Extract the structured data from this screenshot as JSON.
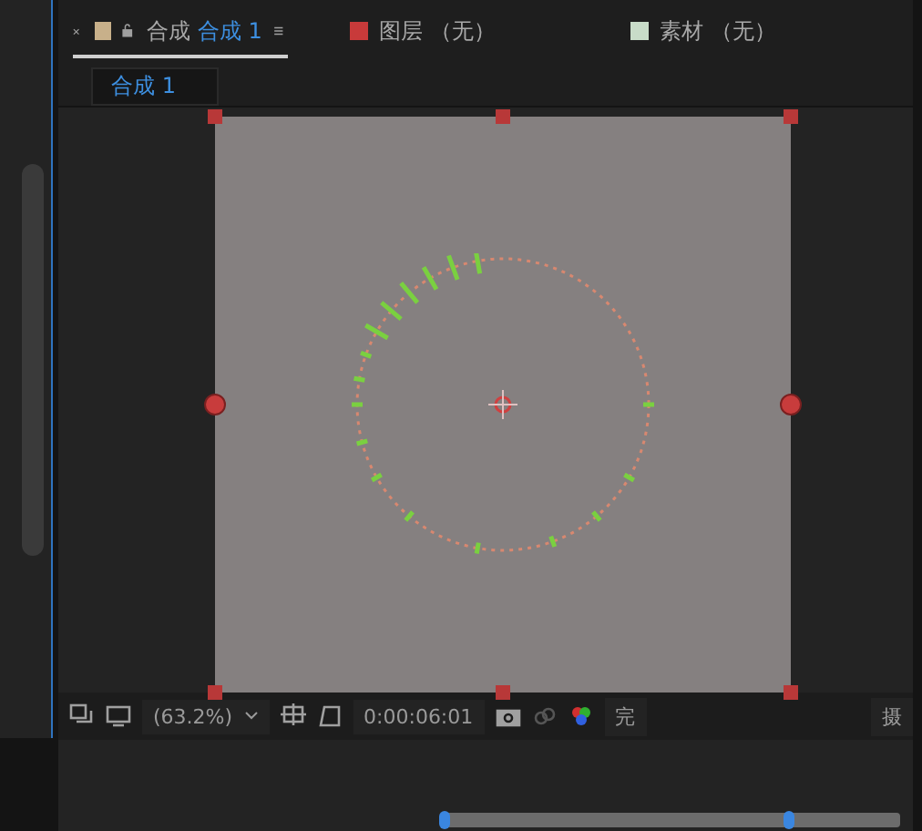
{
  "tabs": [
    {
      "kind": "comp",
      "label": "合成",
      "name": "合成 1",
      "selected": true,
      "color": "#c8b08a"
    },
    {
      "kind": "layer",
      "label": "图层 （无）",
      "selected": false,
      "color": "#c83a3a"
    },
    {
      "kind": "footage",
      "label": "素材 （无）",
      "selected": false,
      "color": "#c8dcc8"
    }
  ],
  "subtab": {
    "label": "合成 1",
    "selected": true
  },
  "toolbar": {
    "zoom": "(63.2%)",
    "timecode": "0:00:06:01",
    "resolution": "完",
    "extra": "摄"
  }
}
